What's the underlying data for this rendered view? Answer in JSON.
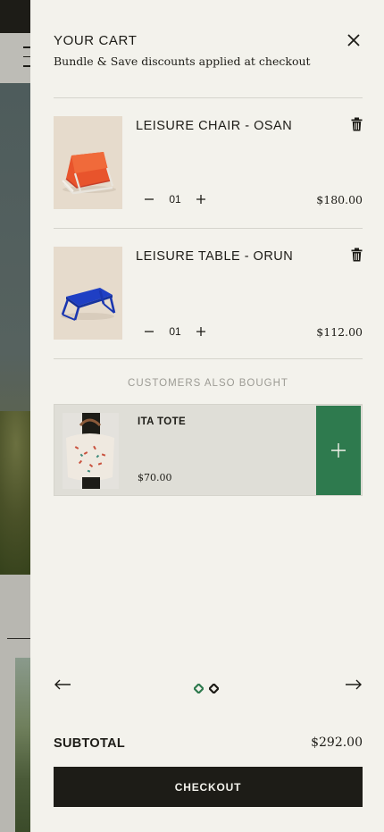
{
  "cart": {
    "title": "YOUR CART",
    "subtitle": "Bundle & Save discounts applied at checkout"
  },
  "items": [
    {
      "name": "LEISURE CHAIR - OSAN",
      "qty": "01",
      "price": "$180.00",
      "image_icon": "orange-chair"
    },
    {
      "name": "LEISURE TABLE - ORUN",
      "qty": "01",
      "price": "$112.00",
      "image_icon": "blue-table"
    }
  ],
  "also_bought": {
    "title": "CUSTOMERS ALSO BOUGHT",
    "products": [
      {
        "name": "ITA TOTE",
        "price": "$70.00",
        "image_icon": "tote-bag"
      }
    ],
    "pagination": {
      "pages": 2,
      "active": 0
    }
  },
  "subtotal": {
    "label": "SUBTOTAL",
    "value": "$292.00"
  },
  "checkout_label": "CHECKOUT",
  "colors": {
    "drawer_bg": "#f3f2ec",
    "text": "#1d1c17",
    "muted": "#9c9b94",
    "accent_green": "#2e7a4e",
    "checkout_bg": "#1d1c17"
  }
}
